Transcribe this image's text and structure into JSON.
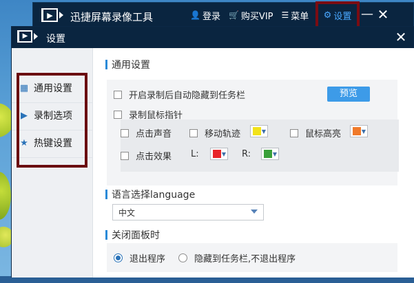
{
  "main_window": {
    "title": "迅捷屏幕录像工具",
    "actions": {
      "login": "登录",
      "buy_vip": "购买VIP",
      "menu": "菜单",
      "settings": "设置"
    },
    "controls": {
      "minimize": "—",
      "close": "✕"
    }
  },
  "dialog": {
    "title": "设置",
    "close": "✕",
    "sidebar": {
      "items": [
        {
          "label": "通用设置",
          "icon": "grid-icon"
        },
        {
          "label": "录制选项",
          "icon": "video-icon"
        },
        {
          "label": "热键设置",
          "icon": "star-icon"
        }
      ]
    },
    "general": {
      "section_title": "通用设置",
      "auto_hide_label": "开启录制后自动隐藏到任务栏",
      "record_cursor_label": "录制鼠标指针",
      "preview_button": "预览",
      "click_sound_label": "点击声音",
      "move_track_label": "移动轨迹",
      "cursor_highlight_label": "鼠标高亮",
      "click_effect_label": "点击效果",
      "left_label": "L:",
      "right_label": "R:",
      "colors": {
        "move_track": "#f2e21a",
        "cursor_highlight": "#f07a2a",
        "left": "#e8252a",
        "right": "#3aa03a"
      }
    },
    "language": {
      "section_title": "语言选择language",
      "selected": "中文"
    },
    "close_panel": {
      "section_title": "关闭面板时",
      "option_exit": "退出程序",
      "option_hide": "隐藏到任务栏,不退出程序",
      "selected": "退出程序"
    }
  }
}
